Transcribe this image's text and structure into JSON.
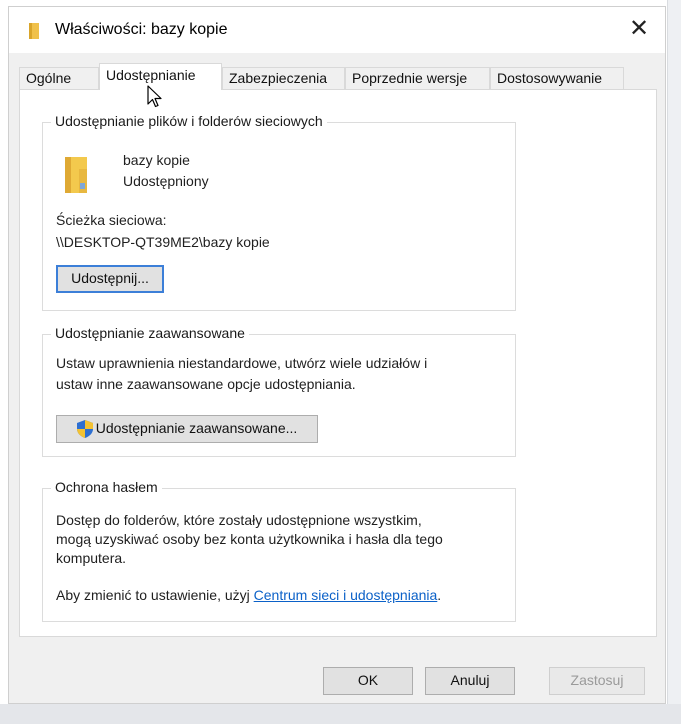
{
  "window": {
    "title": "Właściwości: bazy kopie",
    "close_glyph": "✕"
  },
  "tabs": [
    {
      "label": "Ogólne"
    },
    {
      "label": "Udostępnianie"
    },
    {
      "label": "Zabezpieczenia"
    },
    {
      "label": "Poprzednie wersje"
    },
    {
      "label": "Dostosowywanie"
    }
  ],
  "network_sharing": {
    "legend": "Udostępnianie plików i folderów sieciowych",
    "folder_name": "bazy kopie",
    "share_status": "Udostępniony",
    "network_path_label": "Ścieżka sieciowa:",
    "network_path": "\\\\DESKTOP-QT39ME2\\bazy kopie",
    "share_button": "Udostępnij..."
  },
  "advanced_sharing": {
    "legend": "Udostępnianie zaawansowane",
    "description_line1": "Ustaw uprawnienia niestandardowe, utwórz wiele udziałów i",
    "description_line2": "ustaw inne zaawansowane opcje udostępniania.",
    "button": "Udostępnianie zaawansowane..."
  },
  "password_protection": {
    "legend": "Ochrona hasłem",
    "line1": "Dostęp do folderów, które zostały udostępnione wszystkim,",
    "line2": "mogą uzyskiwać osoby bez konta użytkownika i hasła dla tego",
    "line3": "komputera.",
    "change_prefix": "Aby zmienić to ustawienie, użyj ",
    "change_link": "Centrum sieci i udostępniania",
    "change_suffix": "."
  },
  "footer": {
    "ok": "OK",
    "cancel": "Anuluj",
    "apply": "Zastosuj"
  },
  "colors": {
    "link": "#0b61c8",
    "focus_border": "#3c7fd8",
    "folder_yellow": "#f3c94d"
  }
}
